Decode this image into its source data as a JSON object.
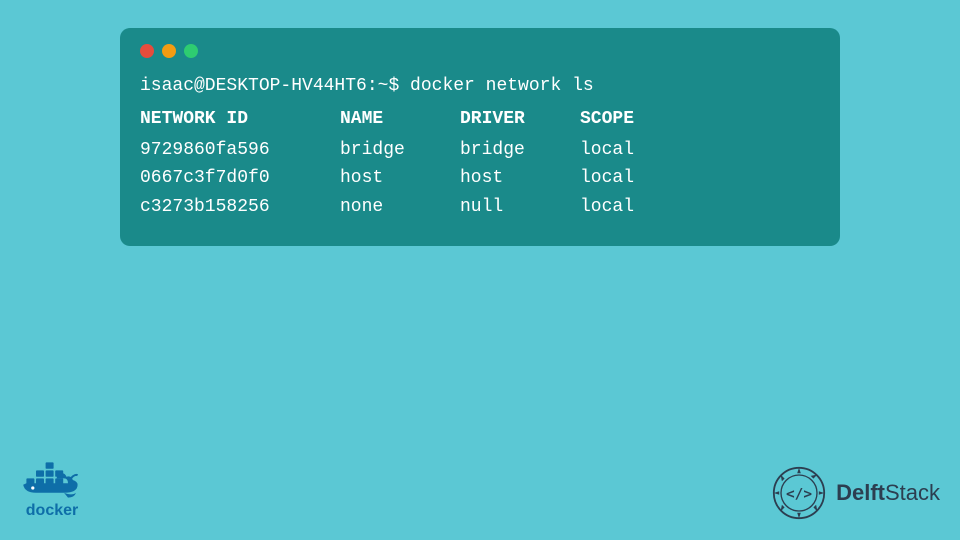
{
  "background": {
    "color": "#5bc8d4"
  },
  "terminal": {
    "background": "#1a8a8a",
    "dots": [
      "red",
      "yellow",
      "green"
    ],
    "command": "isaac@DESKTOP-HV44HT6:~$ docker network ls",
    "header": {
      "col1": "NETWORK ID",
      "col2": "NAME",
      "col3": "DRIVER",
      "col4": "SCOPE"
    },
    "rows": [
      {
        "id": "9729860fa596",
        "name": "bridge",
        "driver": "bridge",
        "scope": "local"
      },
      {
        "id": "0667c3f7d0f0",
        "name": "host",
        "driver": "host",
        "scope": "local"
      },
      {
        "id": "c3273b158256",
        "name": "none",
        "driver": "null",
        "scope": "local"
      }
    ]
  },
  "docker_label": "docker",
  "delftstack_label": "DelftStack"
}
